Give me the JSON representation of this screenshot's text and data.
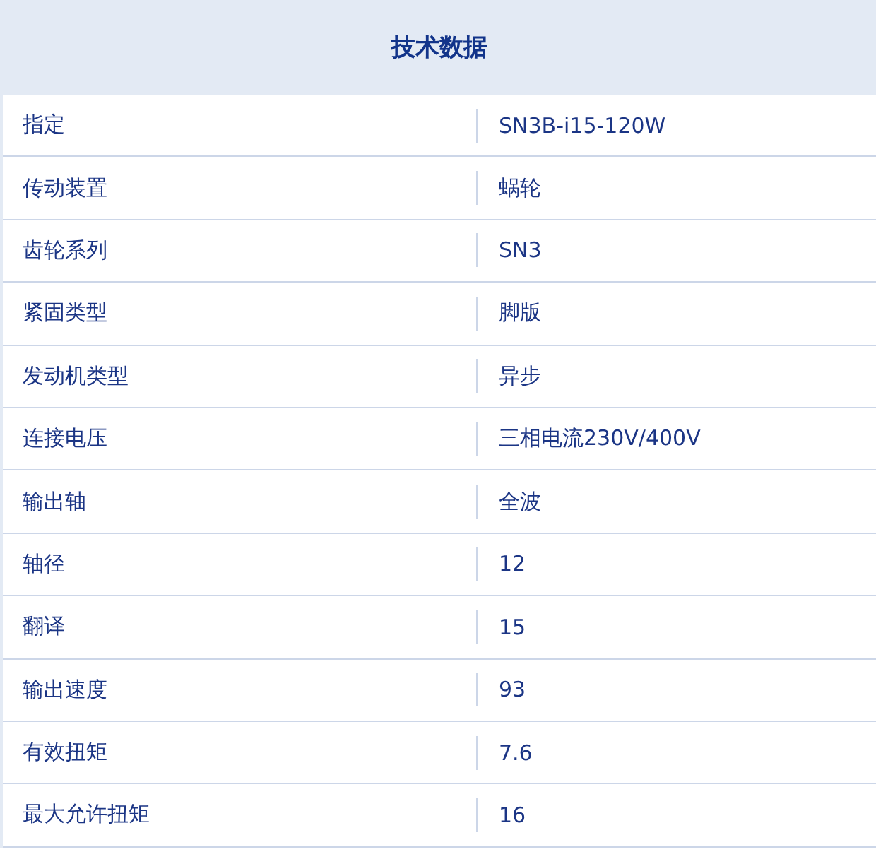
{
  "title": "技术数据",
  "rows": [
    {
      "label": "指定",
      "value": "SN3B-i15-120W"
    },
    {
      "label": "传动装置",
      "value": "蜗轮"
    },
    {
      "label": "齿轮系列",
      "value": "SN3"
    },
    {
      "label": "紧固类型",
      "value": "脚版"
    },
    {
      "label": "发动机类型",
      "value": "异步"
    },
    {
      "label": "连接电压",
      "value": "三相电流230V/400V"
    },
    {
      "label": "输出轴",
      "value": "全波"
    },
    {
      "label": "轴径",
      "value": "12"
    },
    {
      "label": "翻译",
      "value": "15"
    },
    {
      "label": "输出速度",
      "value": "93"
    },
    {
      "label": "有效扭矩",
      "value": "7.6"
    },
    {
      "label": "最大允许扭矩",
      "value": "16"
    }
  ]
}
